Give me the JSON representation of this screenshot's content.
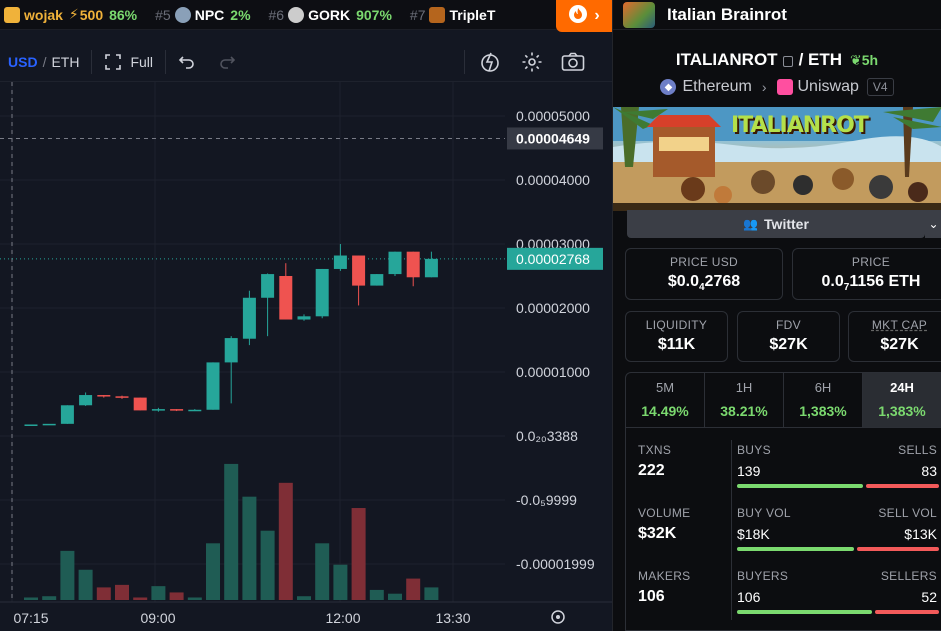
{
  "ticker": {
    "items": [
      {
        "rank": "",
        "name": "wojak",
        "boost": "500",
        "change": "86%",
        "color": "#f0b23a"
      },
      {
        "rank": "#5",
        "name": "NPC",
        "boost": "",
        "change": "2%",
        "color": "#8aa0b8"
      },
      {
        "rank": "#6",
        "name": "GORK",
        "boost": "",
        "change": "907%",
        "color": "#cccccc"
      },
      {
        "rank": "#7",
        "name": "TripleT",
        "boost": "",
        "change": "",
        "color": "#b5651d"
      }
    ],
    "hot_icon": "flame-icon",
    "next_icon": "chevron-right-icon"
  },
  "toolbar": {
    "currency_usd": "USD",
    "separator": "/",
    "currency_eth": "ETH",
    "full_label": "Full",
    "icons": [
      "fullscreen-icon",
      "undo-icon",
      "redo-icon",
      "indicator-icon",
      "settings-icon",
      "camera-icon"
    ]
  },
  "chart_data": {
    "type": "candlestick",
    "price_axis_labels": [
      "0.00005000",
      "0.00004000",
      "0.00003000",
      "0.00002000",
      "0.00001000",
      "0.0₂₀3388",
      "-0.0₅9999",
      "-0.00001999"
    ],
    "crosshair_price": "0.00004649",
    "last_price": "0.00002768",
    "time_labels": [
      "07:15",
      "09:00",
      "12:00",
      "13:30"
    ],
    "candles": [
      {
        "o": 1.8e-06,
        "c": 1.8e-06,
        "h": 1.8e-06,
        "l": 1.8e-06
      },
      {
        "o": 1.9e-06,
        "c": 1.9e-06,
        "h": 1.9e-06,
        "l": 1.9e-06
      },
      {
        "o": 1.9e-06,
        "c": 4.8e-06,
        "h": 4.8e-06,
        "l": 1.9e-06
      },
      {
        "o": 4.8e-06,
        "c": 6.4e-06,
        "h": 6.8e-06,
        "l": 4.7e-06
      },
      {
        "o": 6.4e-06,
        "c": 6.2e-06,
        "h": 6.4e-06,
        "l": 6e-06
      },
      {
        "o": 6.2e-06,
        "c": 6e-06,
        "h": 6.3e-06,
        "l": 5.8e-06
      },
      {
        "o": 6e-06,
        "c": 4e-06,
        "h": 6e-06,
        "l": 4e-06
      },
      {
        "o": 4e-06,
        "c": 4.2e-06,
        "h": 4.4e-06,
        "l": 3.8e-06
      },
      {
        "o": 4.2e-06,
        "c": 4e-06,
        "h": 4.2e-06,
        "l": 3.9e-06
      },
      {
        "o": 4e-06,
        "c": 4.1e-06,
        "h": 4.2e-06,
        "l": 3.9e-06
      },
      {
        "o": 4.1e-06,
        "c": 1.15e-05,
        "h": 1.15e-05,
        "l": 4.1e-06
      },
      {
        "o": 1.15e-05,
        "c": 1.53e-05,
        "h": 1.56e-05,
        "l": 5.1e-06
      },
      {
        "o": 1.52e-05,
        "c": 2.16e-05,
        "h": 2.27e-05,
        "l": 1.42e-05
      },
      {
        "o": 2.16e-05,
        "c": 2.53e-05,
        "h": 2.54e-05,
        "l": 1.56e-05
      },
      {
        "o": 2.5e-05,
        "c": 1.82e-05,
        "h": 2.7e-05,
        "l": 1.82e-05
      },
      {
        "o": 1.82e-05,
        "c": 1.87e-05,
        "h": 1.9e-05,
        "l": 1.8e-05
      },
      {
        "o": 1.87e-05,
        "c": 2.61e-05,
        "h": 2.61e-05,
        "l": 1.84e-05
      },
      {
        "o": 2.61e-05,
        "c": 2.82e-05,
        "h": 3e-05,
        "l": 2.58e-05
      },
      {
        "o": 2.82e-05,
        "c": 2.35e-05,
        "h": 2.82e-05,
        "l": 2.04e-05
      },
      {
        "o": 2.35e-05,
        "c": 2.53e-05,
        "h": 2.53e-05,
        "l": 2.35e-05
      },
      {
        "o": 2.53e-05,
        "c": 2.88e-05,
        "h": 2.88e-05,
        "l": 2.5e-05
      },
      {
        "o": 2.88e-05,
        "c": 2.48e-05,
        "h": 2.88e-05,
        "l": 2.34e-05
      },
      {
        "o": 2.48e-05,
        "c": 2.768e-05,
        "h": 2.88e-05,
        "l": 2.48e-05
      }
    ],
    "volumes": [
      0.2,
      0.3,
      3.9,
      2.4,
      1.0,
      1.2,
      0.2,
      1.1,
      0.6,
      0.2,
      4.5,
      10.8,
      8.2,
      5.5,
      9.3,
      0.3,
      4.5,
      2.8,
      7.3,
      0.8,
      0.5,
      1.7,
      1.0
    ],
    "volume_up": [
      true,
      true,
      true,
      true,
      false,
      false,
      false,
      true,
      false,
      true,
      true,
      true,
      true,
      true,
      false,
      true,
      true,
      true,
      false,
      true,
      true,
      false,
      true
    ],
    "colors": {
      "up": "#26a69a",
      "down": "#ef5350",
      "up_vol": "#1f5c54",
      "down_vol": "#7f2e36",
      "grid": "#1e222d"
    }
  },
  "panel": {
    "title": "Italian Brainrot",
    "symbol": "ITALIANROT",
    "quote": "ETH",
    "age": "5h",
    "chain": "Ethereum",
    "dex": "Uniswap",
    "dex_version": "V4",
    "banner_text": "ITALIANROT",
    "twitter_label": "Twitter",
    "price_usd_label": "PRICE USD",
    "price_usd_prefix": "$0.0",
    "price_usd_sub": "4",
    "price_usd_suffix": "2768",
    "price_label": "PRICE",
    "price_eth_prefix": "0.0",
    "price_eth_sub": "7",
    "price_eth_suffix": "1156 ETH",
    "liquidity_label": "LIQUIDITY",
    "liquidity": "$11K",
    "fdv_label": "FDV",
    "fdv": "$27K",
    "mktcap_label": "MKT CAP",
    "mktcap": "$27K",
    "timeframes": [
      {
        "label": "5M",
        "value": "14.49%"
      },
      {
        "label": "1H",
        "value": "38.21%"
      },
      {
        "label": "6H",
        "value": "1,383%"
      },
      {
        "label": "24H",
        "value": "1,383%"
      }
    ],
    "txns_label": "TXNS",
    "txns": "222",
    "buys_label": "BUYS",
    "buys": "139",
    "buys_frac": 0.626,
    "sells_label": "SELLS",
    "sells": "83",
    "volume_label": "VOLUME",
    "volume": "$32K",
    "buy_vol_label": "BUY VOL",
    "buy_vol": "$18K",
    "buy_vol_frac": 0.58,
    "sell_vol_label": "SELL VOL",
    "sell_vol": "$13K",
    "makers_label": "MAKERS",
    "makers": "106",
    "buyers_label": "BUYERS",
    "buyers": "106",
    "buyers_frac": 0.67,
    "sellers_label": "SELLERS",
    "sellers": "52"
  }
}
